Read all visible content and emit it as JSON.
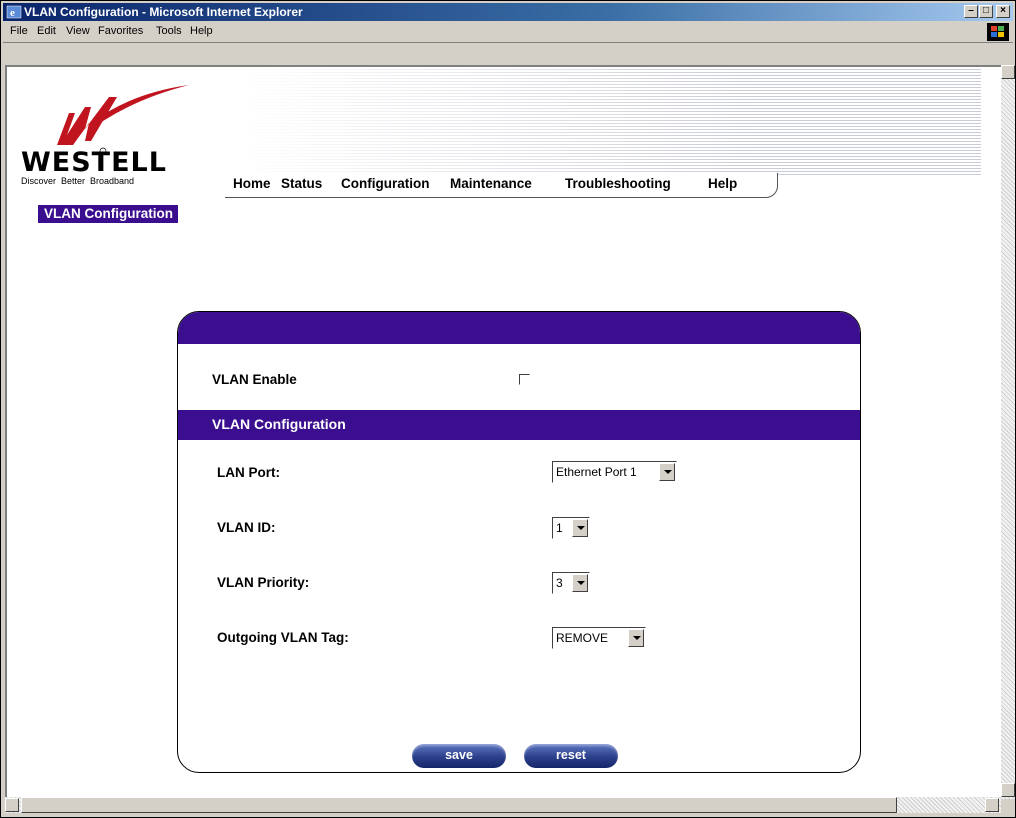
{
  "window": {
    "title": "VLAN Configuration - Microsoft Internet Explorer"
  },
  "menu": [
    "File",
    "Edit",
    "View",
    "Favorites",
    "Tools",
    "Help"
  ],
  "brand": {
    "name": "WESTELL",
    "tagline": "Discover  Better  Broadband"
  },
  "nav": [
    "Home",
    "Status",
    "Configuration",
    "Maintenance",
    "Troubleshooting",
    "Help"
  ],
  "page_badge": "VLAN Configuration",
  "form": {
    "vlan_enable_label": "VLAN Enable",
    "vlan_enable_checked": false,
    "section_title": "VLAN Configuration",
    "lan_port": {
      "label": "LAN Port:",
      "value": "Ethernet Port 1"
    },
    "vlan_id": {
      "label": "VLAN ID:",
      "value": "1"
    },
    "vlan_priority": {
      "label": "VLAN Priority:",
      "value": "3"
    },
    "outgoing_tag": {
      "label": "Outgoing VLAN Tag:",
      "value": "REMOVE"
    },
    "save_label": "save",
    "reset_label": "reset"
  },
  "colors": {
    "accent": "#3a0e8e",
    "button": "#2c3f8a",
    "logo_red": "#c0141e"
  }
}
